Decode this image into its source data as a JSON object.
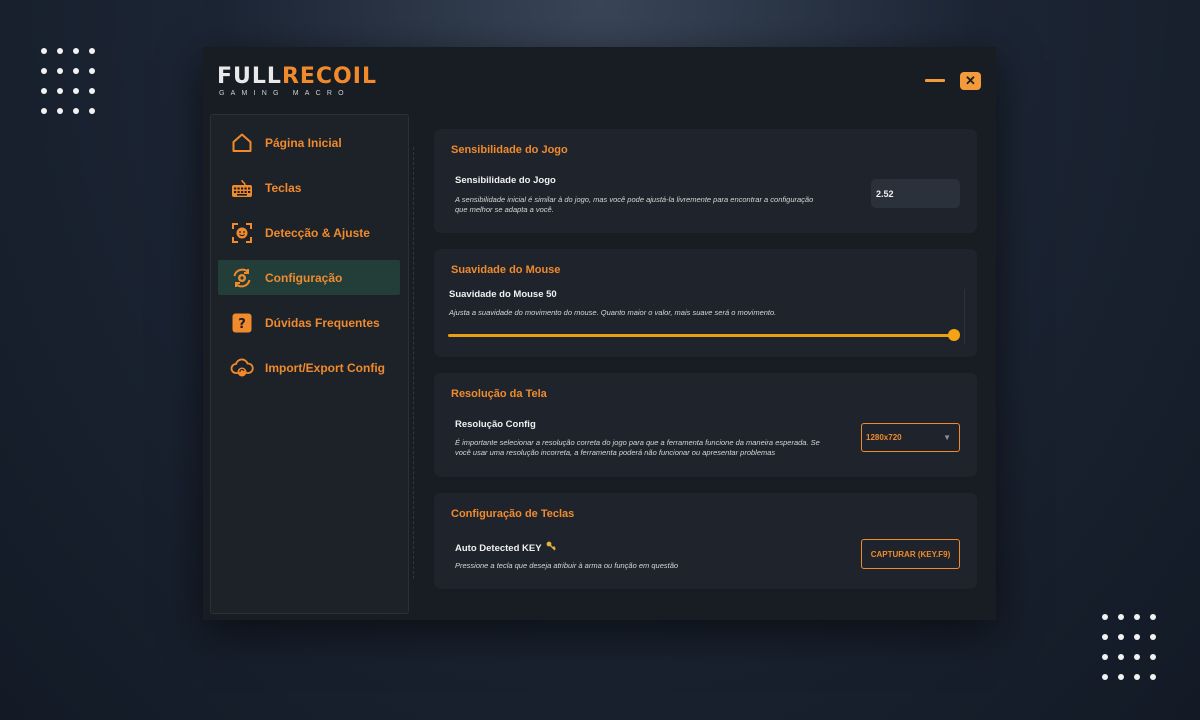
{
  "app": {
    "logo_part1": "FULL",
    "logo_part2": "RECOIL",
    "logo_subtitle": "GAMING MACRO",
    "close_glyph": "✕"
  },
  "colors": {
    "accent": "#f08a2c",
    "active_nav_bg": "#233e39",
    "slider": "#e9a012",
    "window_bg": "#181d24",
    "card_bg": "#1f242c"
  },
  "sidebar": {
    "items": [
      {
        "label": "Página Inicial",
        "icon": "home-icon",
        "active": false
      },
      {
        "label": "Teclas",
        "icon": "keyboard-icon",
        "active": false
      },
      {
        "label": "Detecção & Ajuste",
        "icon": "face-scan-icon",
        "active": false
      },
      {
        "label": "Configuração",
        "icon": "settings-sync-icon",
        "active": true
      },
      {
        "label": "Dúvidas Frequentes",
        "icon": "question-icon",
        "active": false
      },
      {
        "label": "Import/Export Config",
        "icon": "cloud-sync-icon",
        "active": false
      }
    ]
  },
  "sensitivity": {
    "section_title": "Sensibilidade do Jogo",
    "option_title": "Sensibilidade do Jogo",
    "desc_line1": "A sensibilidade inicial é similar à do jogo, mas você pode ajustá-la livremente para encontrar a configuração",
    "desc_line2": "que melhor se adapta a você.",
    "value": "2.52"
  },
  "smoothing": {
    "section_title": "Suavidade do Mouse",
    "option_title": "Suavidade do Mouse 50",
    "value": 50,
    "desc": "Ajusta a suavidade do movimento do mouse. Quanto maior o valor, mais suave será o movimento."
  },
  "resolution": {
    "section_title": "Resolução da Tela",
    "option_title": "Resolução Config",
    "desc_line1": "É importante selecionar a resolução correta do jogo para que a ferramenta funcione da maneira esperada. Se",
    "desc_line2": "você usar uma resolução incorreta, a ferramenta poderá não funcionar ou apresentar problemas",
    "selected": "1280x720",
    "arrow": "▼"
  },
  "keys": {
    "section_title": "Configuração de Teclas",
    "option_title": "Auto Detected KEY",
    "desc": "Pressione a tecla que deseja atribuir à arma ou função em questão",
    "button_label": "CAPTURAR (KEY.F9)"
  }
}
